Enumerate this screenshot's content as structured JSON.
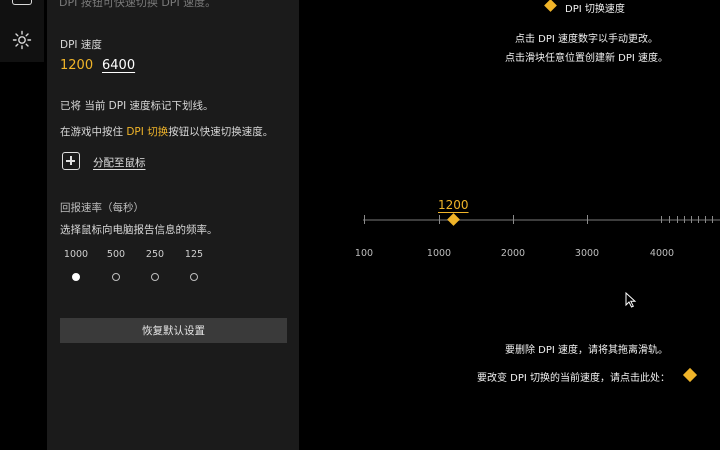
{
  "panel": {
    "cut_off_text": "DPI 按钮可快速切换 DPI 速度。",
    "dpi_section_title": "DPI 速度",
    "dpi_values": [
      "1200",
      "6400"
    ],
    "marked_note": "已将 当前 DPI 速度标记下划线。",
    "hint_prefix": "在游戏中按住 ",
    "hint_accent": "DPI 切换",
    "hint_suffix": "按钮以快速切换速度。",
    "assign_link": "分配至鼠标",
    "rate_title": "回报速率（每秒）",
    "rate_desc": "选择鼠标向电脑报告信息的频率。",
    "rate_options": [
      "1000",
      "500",
      "250",
      "125"
    ],
    "rate_selected": "1000",
    "reset_button": "恢复默认设置"
  },
  "right": {
    "legend": "DPI 切换速度",
    "instr_1": "点击 DPI 速度数字以手动更改。",
    "instr_2": "点击滑块任意位置创建新 DPI 速度。",
    "slider_current": "1200",
    "axis_labels": [
      "100",
      "1000",
      "2000",
      "3000",
      "4000"
    ],
    "delete_hint": "要删除 DPI 速度，请将其拖离滑轨。",
    "change_hint": "要改变 DPI 切换的当前速度，请点击此处："
  },
  "colors": {
    "accent": "#f0b429",
    "panel_bg": "#1b1b1b",
    "page_bg": "#000000"
  },
  "icons": [
    "device-icon",
    "gear-icon",
    "plus-icon",
    "diamond-icon",
    "cursor-icon"
  ]
}
